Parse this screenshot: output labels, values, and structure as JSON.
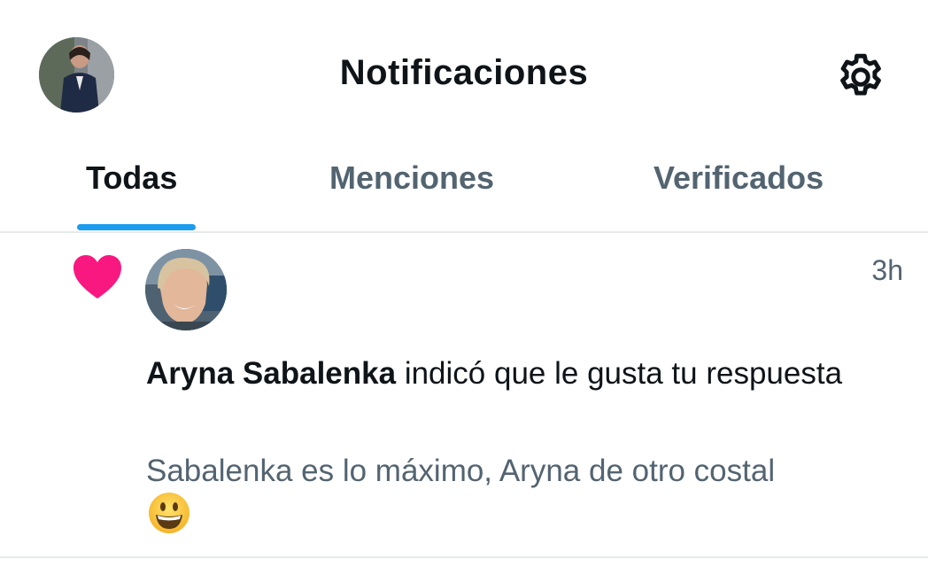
{
  "header": {
    "title": "Notificaciones",
    "avatar_icon": "profile-avatar",
    "settings_icon": "gear-icon"
  },
  "tabs": [
    {
      "label": "Todas",
      "active": true
    },
    {
      "label": "Menciones",
      "active": false
    },
    {
      "label": "Verificados",
      "active": false
    }
  ],
  "colors": {
    "accent": "#1d9bf0",
    "like": "#f91880",
    "secondary_text": "#536471"
  },
  "notifications": [
    {
      "type_icon": "heart-icon",
      "user_name": "Aryna Sabalenka",
      "action": " indicó que le gusta tu respuesta",
      "time": "3h",
      "quoted_text": "Sabalenka es lo máximo, Aryna de otro costal",
      "quoted_emoji": "grinning-face-emoji"
    }
  ]
}
